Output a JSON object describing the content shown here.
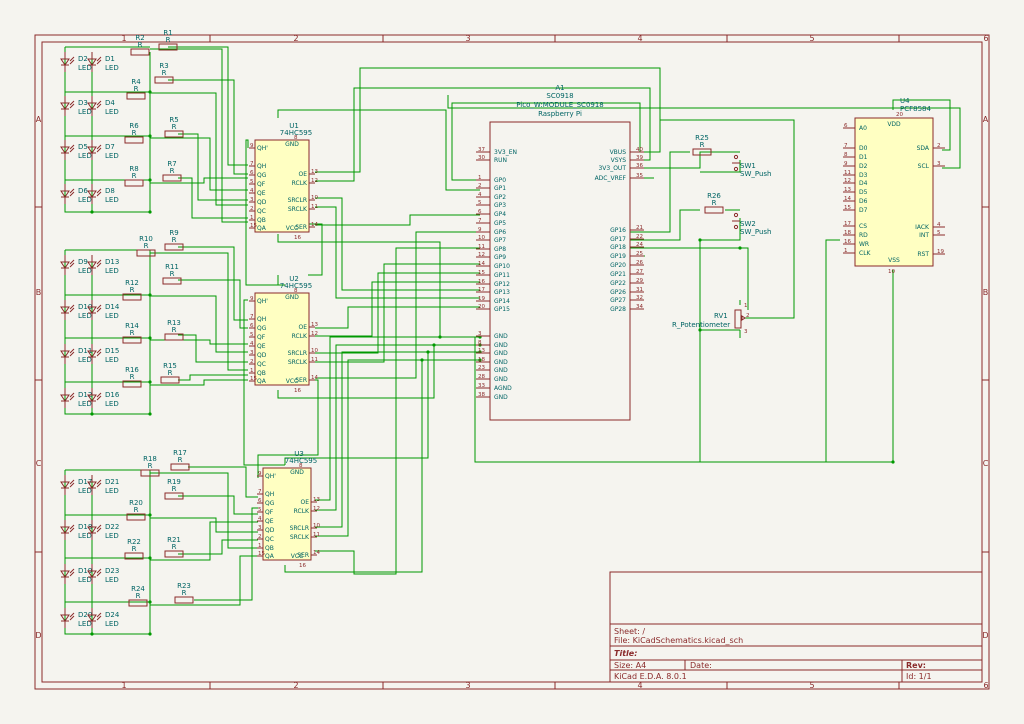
{
  "frame": {
    "col_labels": [
      "1",
      "2",
      "3",
      "4",
      "5",
      "6"
    ],
    "row_labels": [
      "A",
      "B",
      "C",
      "D"
    ]
  },
  "chips595": [
    {
      "ref": "U1",
      "value": "74HC595"
    },
    {
      "ref": "U2",
      "value": "74HC595"
    },
    {
      "ref": "U3",
      "value": "74HC595"
    }
  ],
  "chip595_pins": {
    "left": [
      {
        "num": "9",
        "name": "QH'"
      },
      {
        "num": "7",
        "name": "QH"
      },
      {
        "num": "6",
        "name": "QG"
      },
      {
        "num": "5",
        "name": "QF"
      },
      {
        "num": "4",
        "name": "QE"
      },
      {
        "num": "3",
        "name": "QD"
      },
      {
        "num": "2",
        "name": "QC"
      },
      {
        "num": "1",
        "name": "QB"
      },
      {
        "num": "15",
        "name": "QA"
      }
    ],
    "right": [
      {
        "num": "13",
        "name": "OE"
      },
      {
        "num": "12",
        "name": "RCLK"
      },
      {
        "num": "10",
        "name": "SRCLR"
      },
      {
        "num": "11",
        "name": "SRCLK"
      },
      {
        "num": "14",
        "name": "SER"
      }
    ],
    "gnd": {
      "num": "8",
      "name": "GND"
    },
    "vcc": {
      "num": "16",
      "name": "VCC"
    }
  },
  "pico": {
    "ref": "A1",
    "value": "SC0918",
    "footprint": "Pico_W:MODULE_SC0918",
    "desc": "Raspberry Pi",
    "left_pins": [
      {
        "num": "37",
        "name": "3V3_EN"
      },
      {
        "num": "30",
        "name": "RUN"
      },
      {
        "num": "1",
        "name": "GP0"
      },
      {
        "num": "2",
        "name": "GP1"
      },
      {
        "num": "4",
        "name": "GP2"
      },
      {
        "num": "5",
        "name": "GP3"
      },
      {
        "num": "6",
        "name": "GP4"
      },
      {
        "num": "7",
        "name": "GP5"
      },
      {
        "num": "9",
        "name": "GP6"
      },
      {
        "num": "10",
        "name": "GP7"
      },
      {
        "num": "11",
        "name": "GP8"
      },
      {
        "num": "12",
        "name": "GP9"
      },
      {
        "num": "14",
        "name": "GP10"
      },
      {
        "num": "15",
        "name": "GP11"
      },
      {
        "num": "16",
        "name": "GP12"
      },
      {
        "num": "17",
        "name": "GP13"
      },
      {
        "num": "19",
        "name": "GP14"
      },
      {
        "num": "20",
        "name": "GP15"
      },
      {
        "num": "3",
        "name": "GND"
      },
      {
        "num": "8",
        "name": "GND"
      },
      {
        "num": "13",
        "name": "GND"
      },
      {
        "num": "18",
        "name": "GND"
      },
      {
        "num": "23",
        "name": "GND"
      },
      {
        "num": "28",
        "name": "GND"
      },
      {
        "num": "33",
        "name": "AGND"
      },
      {
        "num": "38",
        "name": "GND"
      }
    ],
    "right_pins": [
      {
        "num": "40",
        "name": "VBUS"
      },
      {
        "num": "39",
        "name": "VSYS"
      },
      {
        "num": "36",
        "name": "3V3_OUT"
      },
      {
        "num": "35",
        "name": "ADC_VREF"
      },
      {
        "num": "21",
        "name": "GP16"
      },
      {
        "num": "22",
        "name": "GP17"
      },
      {
        "num": "24",
        "name": "GP18"
      },
      {
        "num": "25",
        "name": "GP19"
      },
      {
        "num": "26",
        "name": "GP20"
      },
      {
        "num": "27",
        "name": "GP21"
      },
      {
        "num": "29",
        "name": "GP22"
      },
      {
        "num": "31",
        "name": "GP26"
      },
      {
        "num": "32",
        "name": "GP27"
      },
      {
        "num": "34",
        "name": "GP28"
      }
    ]
  },
  "pcf": {
    "ref": "U4",
    "value": "PCF8584",
    "left_pins": [
      {
        "num": "6",
        "name": "A0"
      },
      {
        "num": "7",
        "name": "D0"
      },
      {
        "num": "8",
        "name": "D1"
      },
      {
        "num": "9",
        "name": "D2"
      },
      {
        "num": "11",
        "name": "D3"
      },
      {
        "num": "12",
        "name": "D4"
      },
      {
        "num": "13",
        "name": "D5"
      },
      {
        "num": "14",
        "name": "D6"
      },
      {
        "num": "15",
        "name": "D7"
      },
      {
        "num": "17",
        "name": "CS"
      },
      {
        "num": "18",
        "name": "RD"
      },
      {
        "num": "16",
        "name": "WR"
      },
      {
        "num": "1",
        "name": "CLK"
      }
    ],
    "right_pins": [
      {
        "num": "2",
        "name": "SDA"
      },
      {
        "num": "3",
        "name": "SCL"
      },
      {
        "num": "4",
        "name": "IACK"
      },
      {
        "num": "5",
        "name": "INT"
      },
      {
        "num": "19",
        "name": "RST"
      }
    ],
    "vdd": {
      "num": "20",
      "name": "VDD"
    },
    "vss": {
      "num": "10",
      "name": "VSS"
    }
  },
  "leds": [
    {
      "ref": "D2",
      "val": "LED"
    },
    {
      "ref": "D1",
      "val": "LED"
    },
    {
      "ref": "D3",
      "val": "LED"
    },
    {
      "ref": "D4",
      "val": "LED"
    },
    {
      "ref": "D5",
      "val": "LED"
    },
    {
      "ref": "D7",
      "val": "LED"
    },
    {
      "ref": "D6",
      "val": "LED"
    },
    {
      "ref": "D8",
      "val": "LED"
    },
    {
      "ref": "D9",
      "val": "LED"
    },
    {
      "ref": "D13",
      "val": "LED"
    },
    {
      "ref": "D10",
      "val": "LED"
    },
    {
      "ref": "D14",
      "val": "LED"
    },
    {
      "ref": "D11",
      "val": "LED"
    },
    {
      "ref": "D15",
      "val": "LED"
    },
    {
      "ref": "D12",
      "val": "LED"
    },
    {
      "ref": "D16",
      "val": "LED"
    },
    {
      "ref": "D17",
      "val": "LED"
    },
    {
      "ref": "D21",
      "val": "LED"
    },
    {
      "ref": "D18",
      "val": "LED"
    },
    {
      "ref": "D22",
      "val": "LED"
    },
    {
      "ref": "D19",
      "val": "LED"
    },
    {
      "ref": "D23",
      "val": "LED"
    },
    {
      "ref": "D20",
      "val": "LED"
    },
    {
      "ref": "D24",
      "val": "LED"
    }
  ],
  "resistors": [
    {
      "ref": "R2",
      "val": "R"
    },
    {
      "ref": "R1",
      "val": "R"
    },
    {
      "ref": "R4",
      "val": "R"
    },
    {
      "ref": "R3",
      "val": "R"
    },
    {
      "ref": "R6",
      "val": "R"
    },
    {
      "ref": "R5",
      "val": "R"
    },
    {
      "ref": "R8",
      "val": "R"
    },
    {
      "ref": "R7",
      "val": "R"
    },
    {
      "ref": "R10",
      "val": "R"
    },
    {
      "ref": "R9",
      "val": "R"
    },
    {
      "ref": "R12",
      "val": "R"
    },
    {
      "ref": "R11",
      "val": "R"
    },
    {
      "ref": "R14",
      "val": "R"
    },
    {
      "ref": "R13",
      "val": "R"
    },
    {
      "ref": "R16",
      "val": "R"
    },
    {
      "ref": "R15",
      "val": "R"
    },
    {
      "ref": "R18",
      "val": "R"
    },
    {
      "ref": "R17",
      "val": "R"
    },
    {
      "ref": "R20",
      "val": "R"
    },
    {
      "ref": "R19",
      "val": "R"
    },
    {
      "ref": "R22",
      "val": "R"
    },
    {
      "ref": "R21",
      "val": "R"
    },
    {
      "ref": "R24",
      "val": "R"
    },
    {
      "ref": "R23",
      "val": "R"
    }
  ],
  "switches": [
    {
      "rref": "R25",
      "rval": "R",
      "ref": "SW1",
      "val": "SW_Push"
    },
    {
      "rref": "R26",
      "rval": "R",
      "ref": "SW2",
      "val": "SW_Push"
    }
  ],
  "pot": {
    "ref": "RV1",
    "val": "R_Potentiometer",
    "pins": [
      "1",
      "2",
      "3"
    ]
  },
  "title_block": {
    "sheet": "Sheet: /",
    "file": "File: KiCadSchematics.kicad_sch",
    "title": "Title:",
    "size": "Size: A4",
    "date": "Date:",
    "rev": "Rev:",
    "tool": "KiCad E.D.A. 8.0.1",
    "id": "Id: 1/1"
  }
}
